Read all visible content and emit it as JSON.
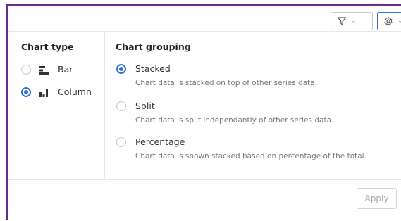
{
  "toolbar": {
    "filter_icon": "filter-icon",
    "settings_icon": "gear-icon",
    "chevron": "⌄"
  },
  "chart_type": {
    "title": "Chart type",
    "options": [
      {
        "label": "Bar",
        "icon": "bar-chart-icon",
        "checked": false
      },
      {
        "label": "Column",
        "icon": "column-chart-icon",
        "checked": true
      }
    ]
  },
  "chart_grouping": {
    "title": "Chart grouping",
    "options": [
      {
        "label": "Stacked",
        "description": "Chart data is stacked on top of other series data.",
        "checked": true
      },
      {
        "label": "Split",
        "description": "Chart data is split independantly of other series data.",
        "checked": false
      },
      {
        "label": "Percentage",
        "description": "Chart data is shown stacked based on percentage of the total.",
        "checked": false
      }
    ]
  },
  "footer": {
    "apply_label": "Apply"
  },
  "colors": {
    "accent": "#2f6fd6",
    "panel_border": "#6a2c91"
  }
}
